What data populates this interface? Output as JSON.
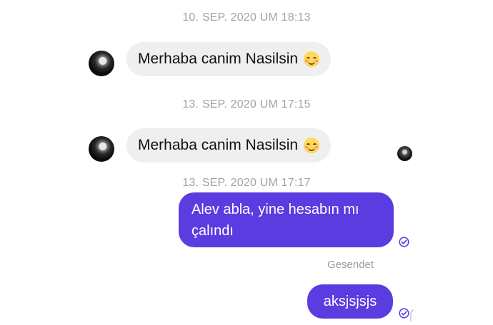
{
  "messages": {
    "timestamp_1": "10. SEP. 2020 UM 18:13",
    "incoming_1": "Merhaba canim Nasilsin",
    "incoming_1_emoji": "smiling-face-emoji",
    "timestamp_2": "13. SEP. 2020 UM 17:15",
    "incoming_2": "Merhaba canim Nasilsin",
    "incoming_2_emoji": "smiling-face-emoji",
    "timestamp_3": "13. SEP. 2020 UM 17:17",
    "outgoing_1_line1": "Alev abla, yine hesabın mı",
    "outgoing_1_line2": "çalındı",
    "status_sent": "Gesendet",
    "outgoing_2": "aksjsjsjs"
  },
  "colors": {
    "outgoing_bubble": "#5b3ce0",
    "incoming_bubble": "#efefef",
    "timestamp_text": "#a2a2a2",
    "read_check": "#5b3ce0"
  }
}
